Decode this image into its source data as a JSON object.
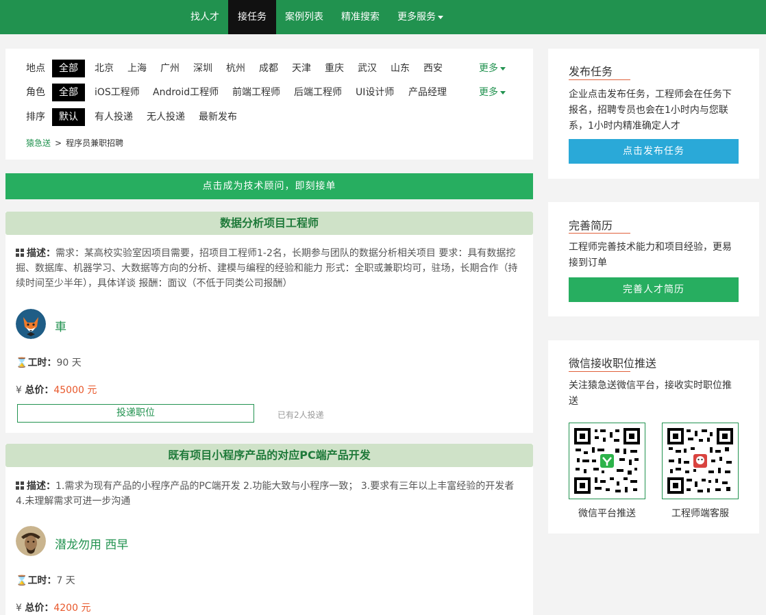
{
  "nav": {
    "items": [
      {
        "label": "找人才"
      },
      {
        "label": "接任务"
      },
      {
        "label": "案例列表"
      },
      {
        "label": "精准搜索"
      },
      {
        "label": "更多服务"
      }
    ]
  },
  "filters": {
    "location": {
      "label": "地点",
      "options": [
        "全部",
        "北京",
        "上海",
        "广州",
        "深圳",
        "杭州",
        "成都",
        "天津",
        "重庆",
        "武汉",
        "山东",
        "西安"
      ],
      "more": "更多"
    },
    "role": {
      "label": "角色",
      "options": [
        "全部",
        "iOS工程师",
        "Android工程师",
        "前端工程师",
        "后端工程师",
        "UI设计师",
        "产品经理"
      ],
      "more": "更多"
    },
    "sort": {
      "label": "排序",
      "options": [
        "默认",
        "有人投递",
        "无人投递",
        "最新发布"
      ]
    }
  },
  "breadcrumb": {
    "home": "猿急送",
    "sep": ">",
    "current": "程序员兼职招聘"
  },
  "cta": {
    "label": "点击成为技术顾问，即刻接单"
  },
  "jobs": [
    {
      "title": "数据分析项目工程师",
      "desc_label": "描述：",
      "desc": "需求：某高校实验室因项目需要，招项目工程师1-2名，长期参与团队的数据分析相关项目 要求：具有数据挖掘、数据库、机器学习、大数据等方向的分析、建模与编程的经验和能力 形式：全职或兼职均可，驻场，长期合作（持续时间至少半年），具体详谈 报酬：面议（不低于同类公司报酬）",
      "author": "車",
      "duration_label": "工时：",
      "duration": "90 天",
      "price_label": "总价：",
      "price": "45000 元",
      "apply_label": "投递职位",
      "applied_text": "已有2人投递"
    },
    {
      "title": "既有项目小程序产品的对应PC端产品开发",
      "desc_label": "描述：",
      "desc": "1.需求为现有产品的小程序产品的PC端开发 2.功能大致与小程序一致； 3.要求有三年以上丰富经验的开发者 4.未理解需求可进一步沟通",
      "author": "潜龙勿用 西早",
      "duration_label": "工时：",
      "duration": "7 天",
      "price_label": "总价：",
      "price": "4200 元"
    }
  ],
  "sidebar": {
    "publish": {
      "title": "发布任务",
      "text": "企业点击发布任务，工程师会在任务下报名，招聘专员也会在1小时内与您联系，1小时内精准确定人才",
      "button": "点击发布任务",
      "button_color": "#2aa9d8"
    },
    "resume": {
      "title": "完善简历",
      "text": "工程师完善技术能力和项目经验，更易接到订单",
      "button": "完善人才简历",
      "button_color": "#27ae60"
    },
    "wechat": {
      "title": "微信接收职位推送",
      "text": "关注猿急送微信平台，接收实时职位推送",
      "qr1_caption": "微信平台推送",
      "qr2_caption": "工程师端客服"
    }
  },
  "colors": {
    "brand": "#21924f",
    "price": "#e8572a",
    "title_bg": "#cfe2c8"
  }
}
